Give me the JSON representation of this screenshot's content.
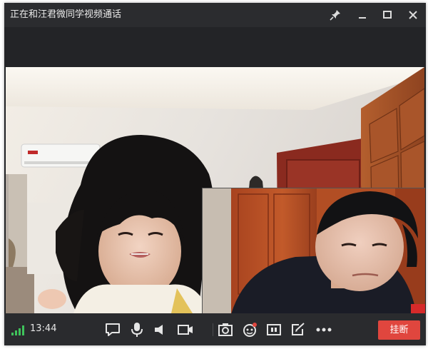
{
  "window": {
    "title": "正在和汪君微同学视频通话"
  },
  "titlebar_icons": [
    "pin-icon",
    "minimize-icon",
    "maximize-icon",
    "close-icon"
  ],
  "controls": {
    "call_duration": "13:44",
    "signal_strength": "4 bars",
    "hangup_label": "挂断",
    "buttons": [
      "chat-icon",
      "microphone-icon",
      "speaker-icon",
      "camera-icon",
      "screenshot-icon",
      "effects-icon",
      "layout-icon",
      "edit-icon",
      "more-icon"
    ]
  },
  "colors": {
    "hangup": "#e0463e",
    "signal": "#3fc35b",
    "notification_dot": "#e0463e"
  }
}
